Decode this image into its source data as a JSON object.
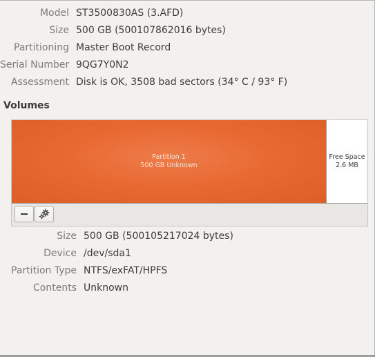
{
  "drive": {
    "model_label": "Model",
    "model_value": "ST3500830AS (3.AFD)",
    "size_label": "Size",
    "size_value": "500 GB (500107862016 bytes)",
    "partitioning_label": "Partitioning",
    "partitioning_value": "Master Boot Record",
    "serial_label": "Serial Number",
    "serial_value": "9QG7Y0N2",
    "assessment_label": "Assessment",
    "assessment_value": "Disk is OK, 3508 bad sectors (34° C / 93° F)"
  },
  "volumes": {
    "heading": "Volumes",
    "partition1_name": "Partition 1",
    "partition1_detail": "500 GB Unknown",
    "free_name": "Free Space",
    "free_detail": "2.6 MB",
    "partition1_color": "#e86a32",
    "toolbar": {
      "remove_icon": "minus-icon",
      "settings_icon": "gears-icon"
    }
  },
  "partition": {
    "size_label": "Size",
    "size_value": "500 GB (500105217024 bytes)",
    "device_label": "Device",
    "device_value": "/dev/sda1",
    "type_label": "Partition Type",
    "type_value": "NTFS/exFAT/HPFS",
    "contents_label": "Contents",
    "contents_value": "Unknown"
  }
}
